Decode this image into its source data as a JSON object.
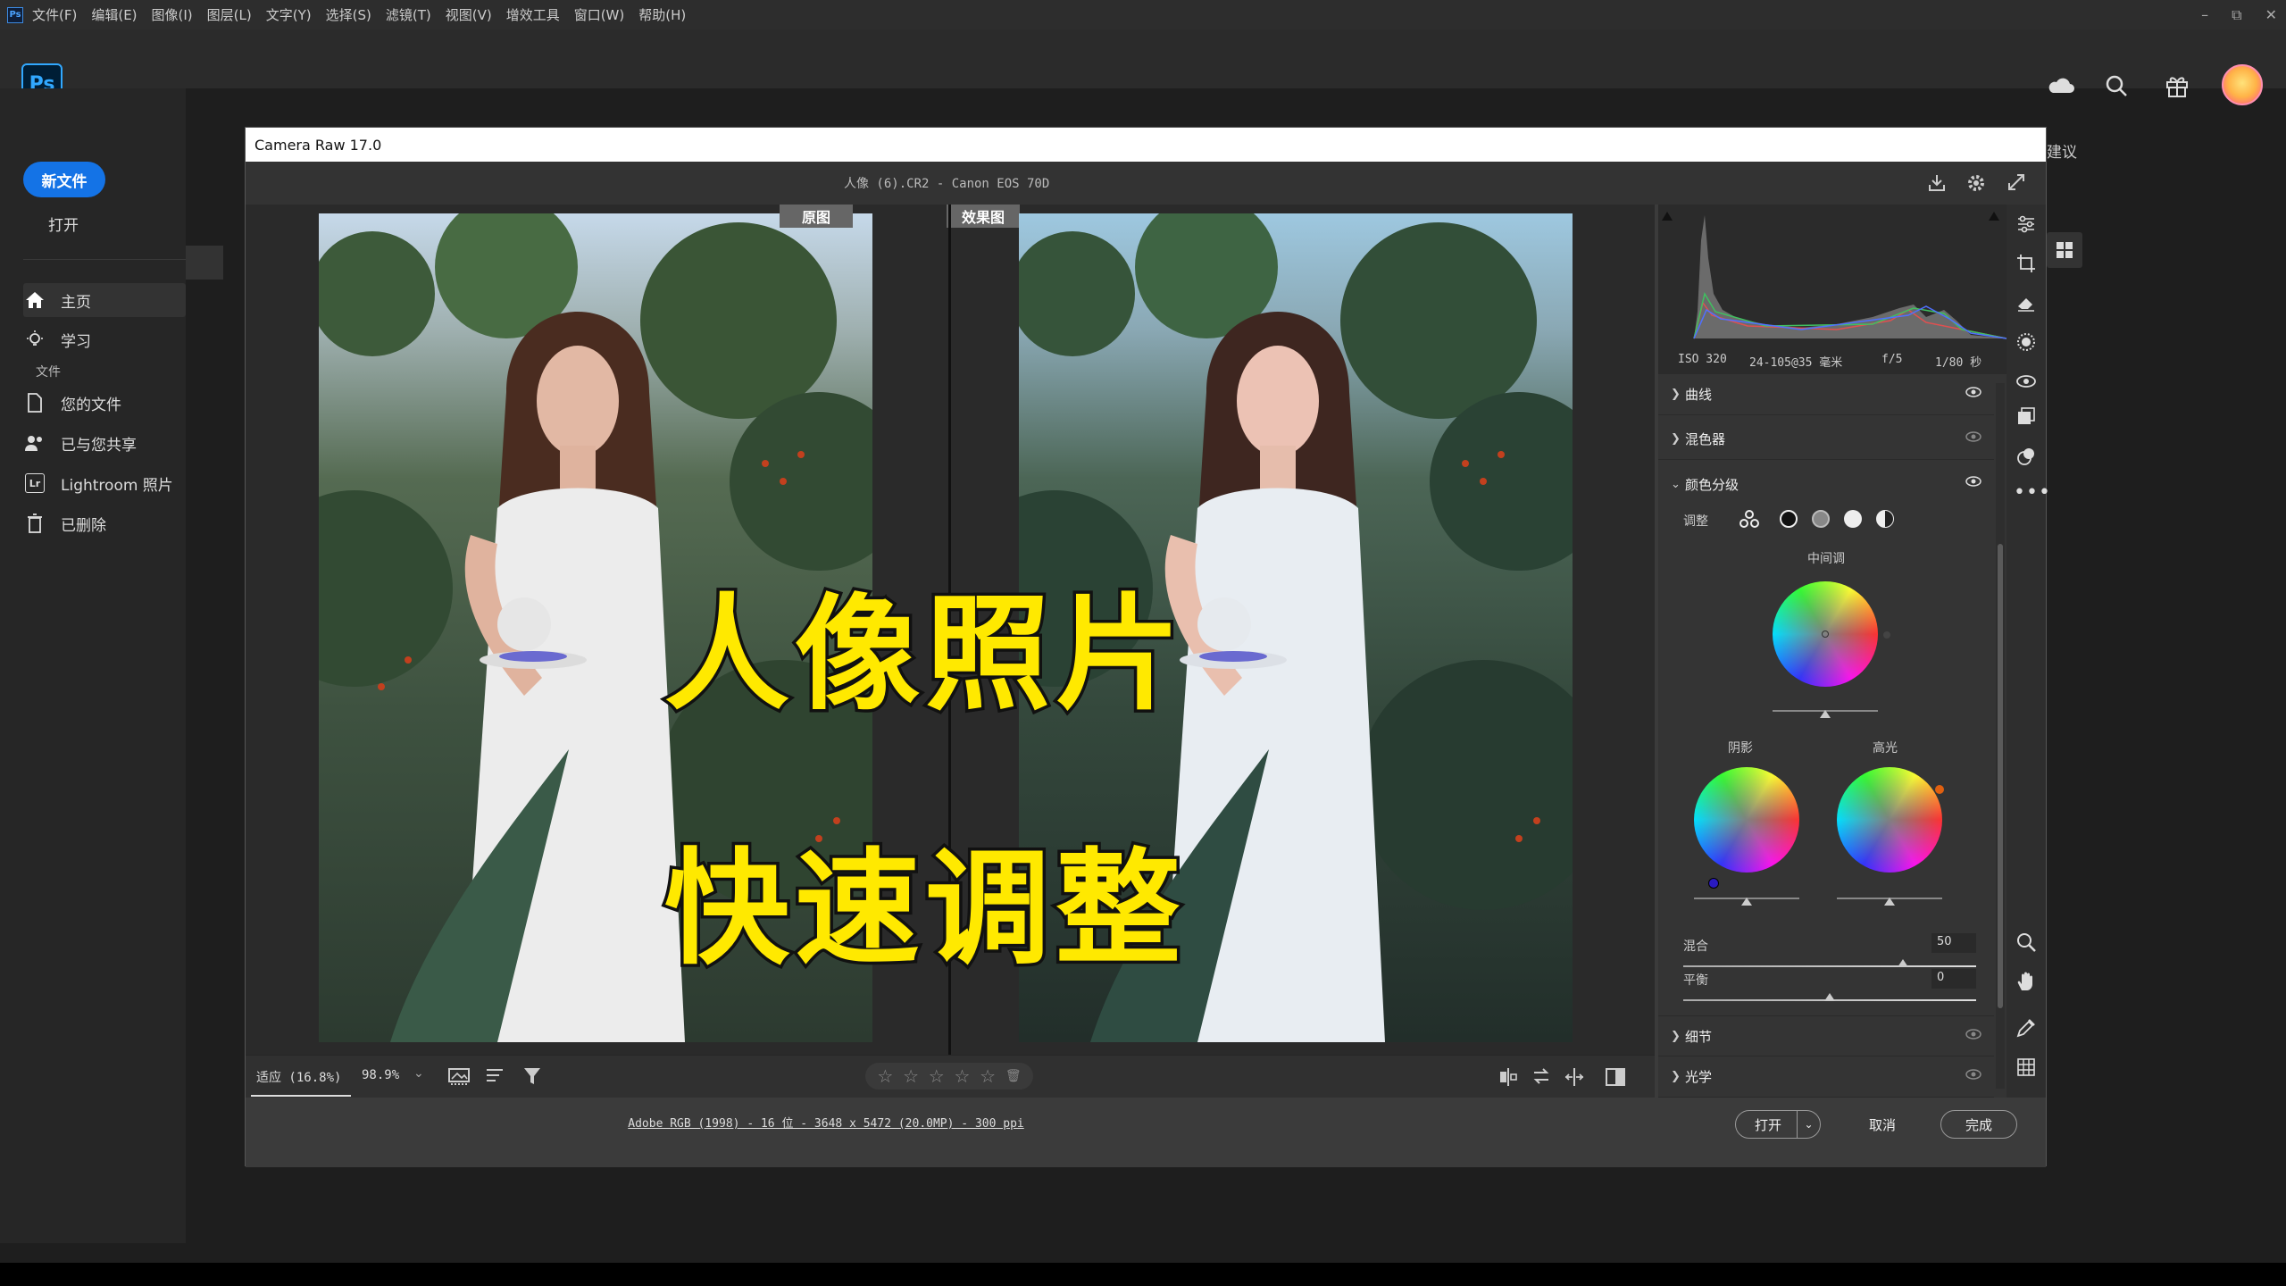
{
  "menubar": {
    "logo": "Ps",
    "items": [
      "文件(F)",
      "编辑(E)",
      "图像(I)",
      "图层(L)",
      "文字(Y)",
      "选择(S)",
      "滤镜(T)",
      "视图(V)",
      "增效工具",
      "窗口(W)",
      "帮助(H)"
    ]
  },
  "window_controls": {
    "minimize": "–",
    "restore": "⧉",
    "close": "✕"
  },
  "ps_logo": "Ps",
  "sidebar": {
    "new_file": "新文件",
    "open": "打开",
    "home": "主页",
    "learn": "学习",
    "files_header": "文件",
    "your_files": "您的文件",
    "shared": "已与您共享",
    "lightroom": "Lightroom 照片",
    "deleted": "已删除"
  },
  "behind_text": "建议",
  "dialog": {
    "title": "Camera Raw 17.0",
    "filename": "人像 (6).CR2 -  Canon EOS 70D",
    "view_tab_before": "原图",
    "view_tab_after": "效果图",
    "zoom_fit": "适应 (16.8%)",
    "zoom_value": "98.9%",
    "file_info": "Adobe RGB (1998) - 16 位 - 3648 x 5472 (20.0MP) - 300 ppi",
    "btn_open": "打开",
    "btn_cancel": "取消",
    "btn_done": "完成"
  },
  "histogram": {
    "iso": "ISO 320",
    "lens": "24-105@35 毫米",
    "aperture": "f/5",
    "shutter": "1/80 秒"
  },
  "panel": {
    "curve": "曲线",
    "mixer": "混色器",
    "grading": "颜色分级",
    "adjust": "调整",
    "midtones": "中间调",
    "shadows": "阴影",
    "highlights": "高光",
    "blend_label": "混合",
    "blend_value": "50",
    "balance_label": "平衡",
    "balance_value": "0",
    "detail": "细节",
    "optics": "光学"
  },
  "overlay": {
    "line1": "人像照片",
    "line2": "快速调整"
  },
  "colors": {
    "accent": "#1473e6",
    "overlay_text": "#ffe900"
  }
}
